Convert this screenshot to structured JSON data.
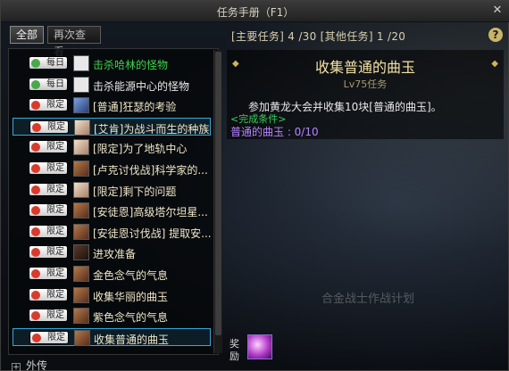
{
  "window": {
    "title": "任务手册（F1）"
  },
  "toolbar": {
    "tabs": [
      {
        "label": "全部"
      },
      {
        "label": "再次查看"
      }
    ],
    "counts": "[主要任务] 4 /30  [其他任务] 1 /20"
  },
  "quests": [
    {
      "badge": "每日",
      "type": "daily",
      "portrait": "blank",
      "name": "击杀哈林的怪物",
      "color": "green"
    },
    {
      "badge": "每日",
      "type": "daily",
      "portrait": "blank",
      "name": "击杀能源中心的怪物",
      "color": "white"
    },
    {
      "badge": "限定",
      "type": "limited",
      "portrait": "blue",
      "name": "[普通]狂瑟的考验",
      "color": "gold"
    },
    {
      "badge": "限定",
      "type": "limited",
      "portrait": "pale",
      "name": "[艾肯]为战斗而生的种族",
      "color": "gold",
      "selected": true
    },
    {
      "badge": "限定",
      "type": "limited",
      "portrait": "pale",
      "name": "[限定]为了地轨中心",
      "color": "gold"
    },
    {
      "badge": "限定",
      "type": "limited",
      "portrait": "brown",
      "name": "[卢克讨伐战]科学家的...",
      "color": "gold"
    },
    {
      "badge": "限定",
      "type": "limited",
      "portrait": "pale",
      "name": "[限定]剩下的问题",
      "color": "gold"
    },
    {
      "badge": "限定",
      "type": "limited",
      "portrait": "brown",
      "name": "[安徒恩]高级塔尔坦星...",
      "color": "gold"
    },
    {
      "badge": "限定",
      "type": "limited",
      "portrait": "brown",
      "name": "[安徒恩讨伐战] 提取安...",
      "color": "gold"
    },
    {
      "badge": "限定",
      "type": "limited",
      "portrait": "dark",
      "name": "进攻准备",
      "color": "gold"
    },
    {
      "badge": "限定",
      "type": "limited",
      "portrait": "brown",
      "name": "金色念气的气息",
      "color": "gold"
    },
    {
      "badge": "限定",
      "type": "limited",
      "portrait": "brown",
      "name": "收集华丽的曲玉",
      "color": "gold"
    },
    {
      "badge": "限定",
      "type": "limited",
      "portrait": "brown",
      "name": "紫色念气的气息",
      "color": "gold"
    },
    {
      "badge": "限定",
      "type": "limited",
      "portrait": "brown",
      "name": "收集普通的曲玉",
      "color": "gold",
      "selected": true
    }
  ],
  "footer": {
    "label": "外传"
  },
  "detail": {
    "title": "收集普通的曲玉",
    "level": "Lv75任务",
    "description": "参加黄龙大会并收集10块[普通的曲玉]。",
    "condition_label": "<完成条件>",
    "progress": "普通的曲玉 : 0/10"
  },
  "reward": {
    "label": "奖励"
  },
  "background": {
    "text": "合金战士作战计划"
  }
}
